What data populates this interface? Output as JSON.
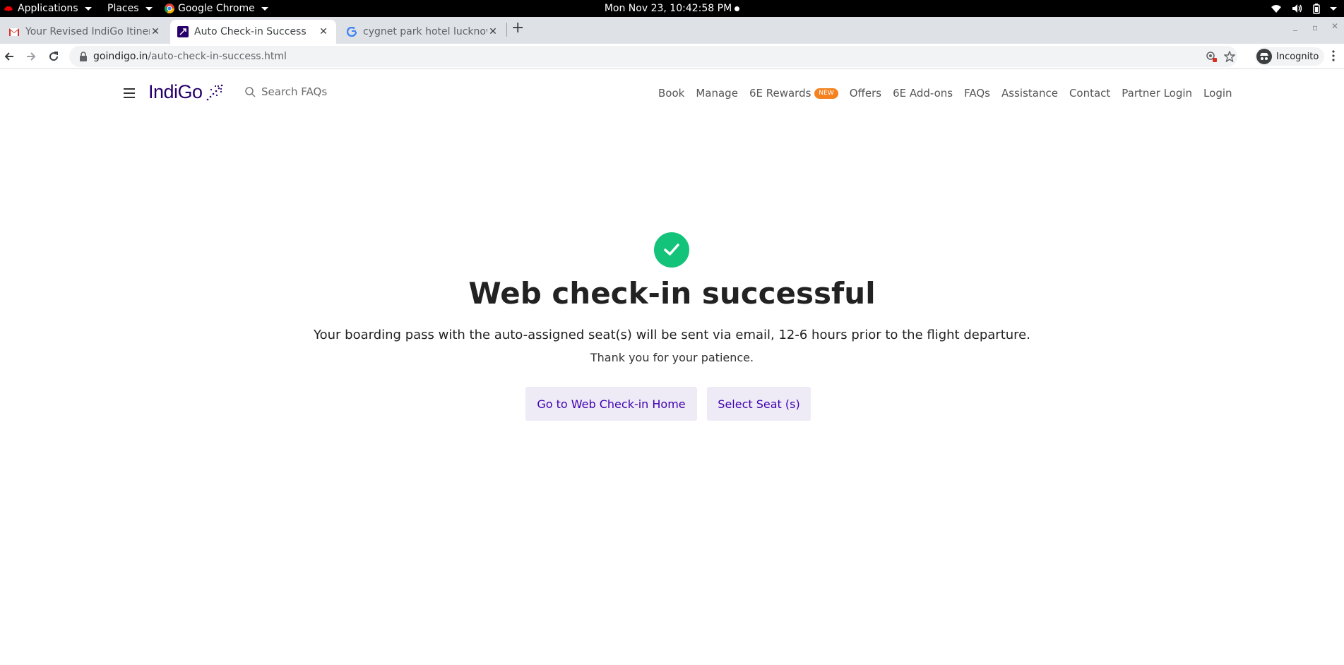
{
  "os_bar": {
    "applications": "Applications",
    "places": "Places",
    "app_name": "Google Chrome",
    "clock": "Mon Nov 23, 10:42:58 PM"
  },
  "browser": {
    "tabs": [
      {
        "title": "Your Revised IndiGo Itinera",
        "favicon": "gmail-icon"
      },
      {
        "title": "Auto Check-in Success",
        "favicon": "indigo-icon"
      },
      {
        "title": "cygnet park hotel lucknow",
        "favicon": "google-icon"
      }
    ],
    "url_domain": "goindigo.in",
    "url_path": "/auto-check-in-success.html",
    "incognito_label": "Incognito"
  },
  "site": {
    "logo": "IndiGo",
    "search_placeholder": "Search FAQs",
    "nav": [
      "Book",
      "Manage",
      "6E Rewards",
      "Offers",
      "6E Add-ons",
      "FAQs",
      "Assistance",
      "Contact",
      "Partner Login",
      "Login"
    ],
    "rewards_badge": "NEW",
    "brand_color": "#27006a",
    "accent_color": "#3d00b0",
    "success_color": "#13c37a"
  },
  "content": {
    "headline": "Web check-in successful",
    "message": "Your boarding pass with the auto-assigned seat(s) will be sent via email, 12-6 hours prior to the flight departure.",
    "thanks": "Thank you for your patience.",
    "primary_button": "Go to Web Check-in Home",
    "secondary_button": "Select Seat (s)"
  }
}
